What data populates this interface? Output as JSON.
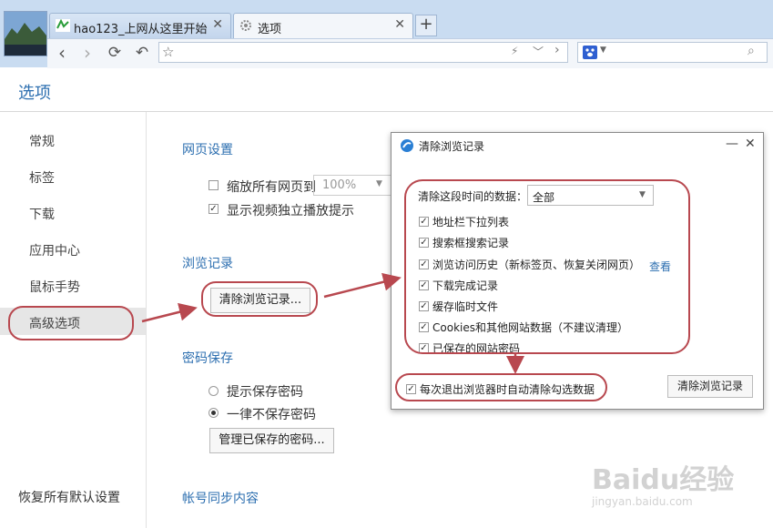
{
  "browser": {
    "tabs": [
      {
        "label": "hao123_上网从这里开始",
        "close": "✕"
      },
      {
        "label": "选项",
        "close": "✕"
      }
    ],
    "new_tab": "+"
  },
  "page": {
    "title": "选项",
    "sidebar": [
      "常规",
      "标签",
      "下载",
      "应用中心",
      "鼠标手势",
      "高级选项"
    ],
    "restore_defaults": "恢复所有默认设置",
    "webpage": {
      "title": "网页设置",
      "zoom_label": "缩放所有网页到",
      "zoom_value": "100%",
      "video_hint": "显示视频独立播放提示"
    },
    "history": {
      "title": "浏览记录",
      "clear_button": "清除浏览记录..."
    },
    "password": {
      "title": "密码保存",
      "opt1": "提示保存密码",
      "opt2": "一律不保存密码",
      "manage_button": "管理已保存的密码..."
    },
    "sync": {
      "title": "帐号同步内容"
    }
  },
  "dialog": {
    "title": "清除浏览记录",
    "range_label": "清除这段时间的数据：",
    "range_value": "全部",
    "items": [
      "地址栏下拉列表",
      "搜索框搜索记录",
      "浏览访问历史（新标签页、恢复关闭网页）",
      "下载完成记录",
      "缓存临时文件",
      "Cookies和其他网站数据（不建议清理）",
      "已保存的网站密码"
    ],
    "view_link": "查看",
    "auto_clear": "每次退出浏览器时自动清除勾选数据",
    "clear_button": "清除浏览记录"
  },
  "watermark": {
    "brand": "Baidu经验",
    "url": "jingyan.baidu.com"
  },
  "colors": {
    "accent": "#2d6fb0",
    "annotation": "#b8484f"
  }
}
